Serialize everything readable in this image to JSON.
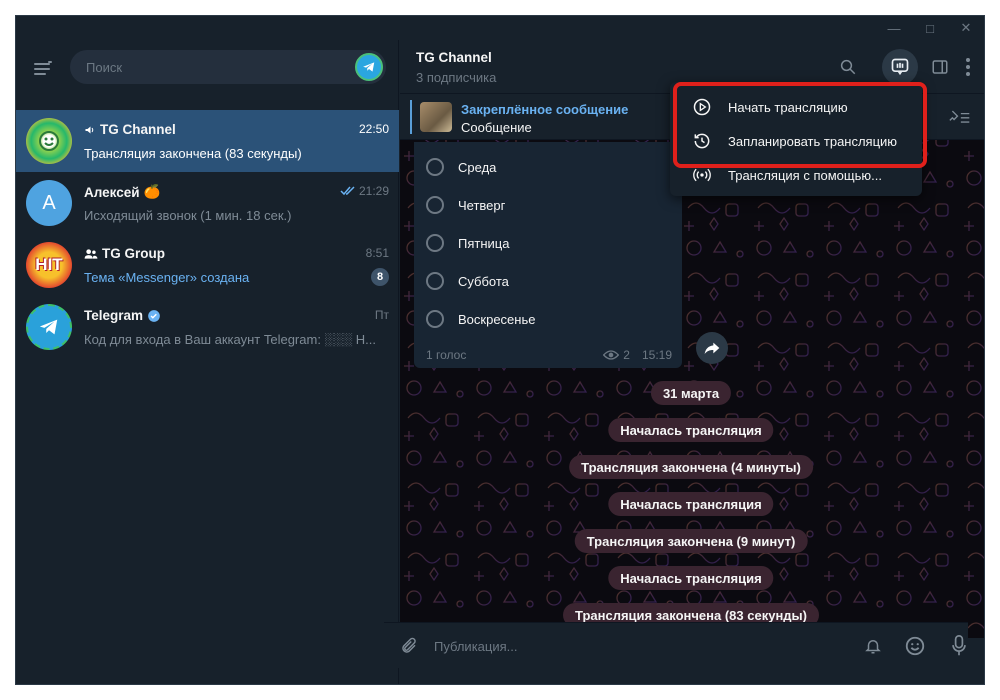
{
  "search": {
    "placeholder": "Поиск"
  },
  "chats": [
    {
      "name": "TG Channel",
      "time": "22:50",
      "preview": "Трансляция закончена (83 секунды)",
      "type": "channel"
    },
    {
      "name": "Алексей",
      "emoji": "🍊",
      "time": "21:29",
      "preview": "Исходящий звонок (1 мин. 18 сек.)",
      "avatar_letter": "А"
    },
    {
      "name": "TG Group",
      "time": "8:51",
      "preview": "Тема «Messenger» создана",
      "unread": "8",
      "avatar_text": "HIT"
    },
    {
      "name": "Telegram",
      "time": "Пт",
      "preview": "Код для входа в Ваш аккаунт Telegram: ░░░ Н..."
    }
  ],
  "header": {
    "title": "TG Channel",
    "subtitle": "3 подписчика"
  },
  "pinned": {
    "title": "Закреплённое сообщение",
    "text": "Сообщение"
  },
  "poll": {
    "options": [
      "Среда",
      "Четверг",
      "Пятница",
      "Суббота",
      "Воскресенье"
    ],
    "votes": "1 голос",
    "views": "2",
    "time": "15:19"
  },
  "service_messages": [
    "31 марта",
    "Началась трансляция",
    "Трансляция закончена (4 минуты)",
    "Началась трансляция",
    "Трансляция закончена (9 минут)",
    "Началась трансляция",
    "Трансляция закончена (83 секунды)"
  ],
  "composer": {
    "placeholder": "Публикация..."
  },
  "dropdown": {
    "items": [
      "Начать трансляцию",
      "Запланировать трансляцию",
      "Трансляция с помощью..."
    ]
  },
  "colors": {
    "accent": "#2b5278",
    "link": "#6ab2f2",
    "highlight": "#e0201b",
    "background": "#17212b"
  }
}
